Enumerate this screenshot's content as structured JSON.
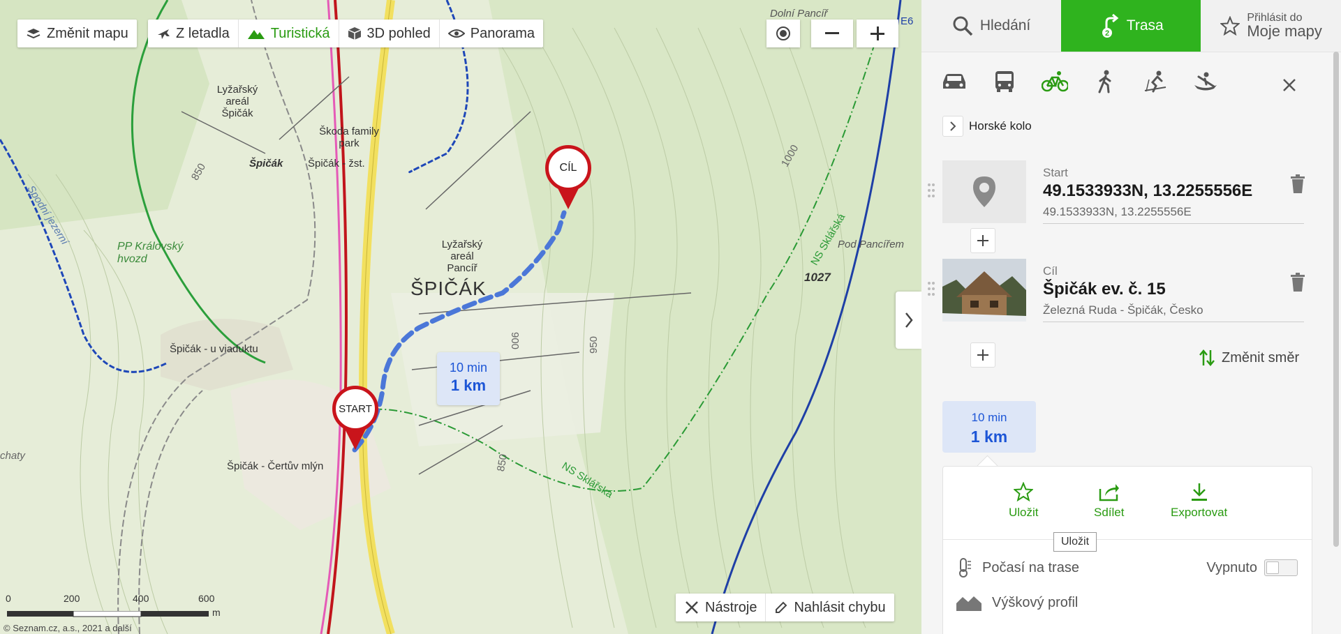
{
  "map": {
    "toolbar": {
      "change_map": "Změnit mapu",
      "aerial": "Z letadla",
      "tourist": "Turistická",
      "view3d": "3D pohled",
      "panorama": "Panorama"
    },
    "labels": {
      "dolni_pancir": "Dolní Pancíř",
      "lyzarsky_spicak": "Lyžařský areál Špičák",
      "skoda_park": "Škoda family park",
      "spicak_small": "Špičák",
      "spicak_zst": "Špičák - žst.",
      "lyzarsky_pancir": "Lyžařský areál Pancíř",
      "pp_kralovsky": "PP Královský hvozd",
      "spicak_town": "ŠPIČÁK",
      "spicak_viadukt": "Špičák - u viaduktu",
      "pod_pancirem": "Pod Pancířem",
      "elev_1027": "1027",
      "spicak_certuv": "Špičák - Čertův mlýn",
      "chaty": "chaty",
      "ns_sklarska": "NS Sklářská",
      "spodni_jezerni": "Spodní jezerní",
      "e6": "E6",
      "c850": "850",
      "c900": "900",
      "c950": "950",
      "c1000": "1000"
    },
    "pins": {
      "start": "START",
      "end": "CÍL"
    },
    "route_bubble": {
      "time": "10 min",
      "distance": "1 km"
    },
    "scale_labels": [
      "0",
      "200",
      "400",
      "600",
      "m"
    ],
    "copyright": "© Seznam.cz, a.s., 2021 a další",
    "tools": "Nástroje",
    "report": "Nahlásit chybu"
  },
  "sidebar": {
    "tabs": {
      "search": "Hledání",
      "route": "Trasa",
      "route_badge": "2",
      "login_small": "Přihlásit do",
      "login_big": "Moje mapy"
    },
    "bike_type": "Horské kolo",
    "start": {
      "caption": "Start",
      "title": "49.1533933N, 13.2255556E",
      "subtitle": "49.1533933N, 13.2255556E"
    },
    "end": {
      "caption": "Cíl",
      "title": "Špičák ev. č. 15",
      "subtitle": "Železná Ruda - Špičák, Česko"
    },
    "swap": "Změnit směr",
    "summary": {
      "time": "10 min",
      "distance": "1 km"
    },
    "actions": {
      "save": "Uložit",
      "share": "Sdílet",
      "export": "Exportovat",
      "tooltip": "Uložit"
    },
    "weather": {
      "label": "Počasí na trase",
      "state": "Vypnuto"
    },
    "elevation": "Výškový profil"
  },
  "colors": {
    "accent": "#2fb31e",
    "route": "#4b77d8",
    "pin": "#c9141b"
  }
}
